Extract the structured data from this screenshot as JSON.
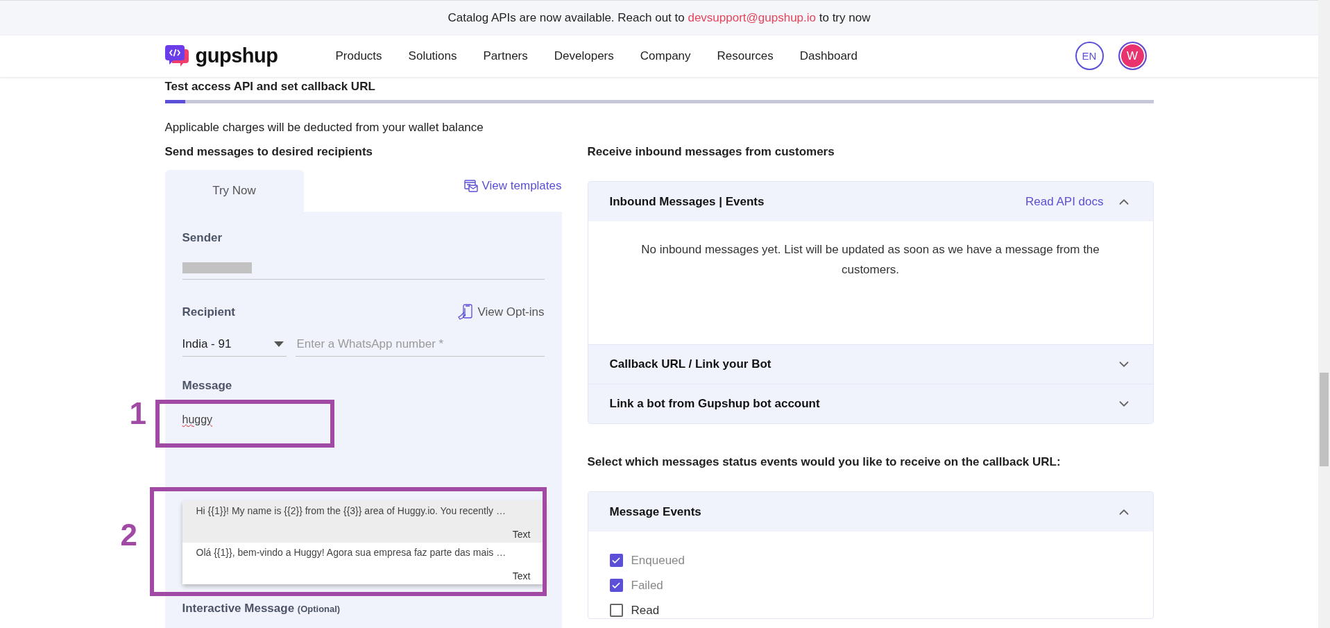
{
  "banner": {
    "text": "Catalog APIs are now available. Reach out to ",
    "email": "devsupport@gupshup.io",
    "text_after": " to try now"
  },
  "header": {
    "logo": "gupshup",
    "nav": [
      "Products",
      "Solutions",
      "Partners",
      "Developers",
      "Company",
      "Resources",
      "Dashboard"
    ],
    "language": "EN",
    "avatar": "W"
  },
  "page": {
    "title": "Test access API and set callback URL",
    "progress": {
      "level": 0.021
    },
    "notice": "Applicable charges will be deducted from your wallet balance"
  },
  "send": {
    "heading": "Send messages to desired recipients",
    "tabs": [
      {
        "label": "Try Now",
        "selected": true
      }
    ],
    "view_templates": "View templates",
    "sender": {
      "label": "Sender"
    },
    "recipient": {
      "label": "Recipient",
      "view_optins": "View Opt-ins",
      "country": "India - 91",
      "number_placeholder": "Enter a WhatsApp number *"
    },
    "message": {
      "label": "Message",
      "value": "huggy",
      "annotation": "1"
    },
    "suggestions": {
      "annotation": "2",
      "items": [
        {
          "text": "Hi {{1}}! My name is {{2}} from the {{3}} area of Huggy.io. You recently …",
          "type": "Text",
          "highlighted": true
        },
        {
          "text": "Olá {{1}}, bem-vindo a Huggy! Agora sua empresa faz parte das mais …",
          "type": "Text",
          "highlighted": false
        }
      ]
    },
    "interactive": {
      "label": "Interactive Message",
      "note": "(Optional)"
    }
  },
  "receive": {
    "heading": "Receive inbound messages from customers",
    "accordions": [
      {
        "title": "Inbound Messages | Events",
        "link": "Read API docs",
        "expanded": true,
        "body": "No inbound messages yet. List will be updated as soon as we have a message from the customers."
      },
      {
        "title": "Callback URL / Link your Bot",
        "expanded": false
      },
      {
        "title": "Link a bot from Gupshup bot account",
        "expanded": false
      }
    ]
  },
  "events": {
    "heading": "Select which messages status events would you like to receive on the callback URL:",
    "accordion": {
      "title": "Message Events",
      "expanded": true,
      "options": [
        {
          "label": "Enqueued",
          "checked": true,
          "disabled": true
        },
        {
          "label": "Failed",
          "checked": true,
          "disabled": true
        },
        {
          "label": "Read",
          "checked": false,
          "disabled": false
        }
      ]
    }
  }
}
